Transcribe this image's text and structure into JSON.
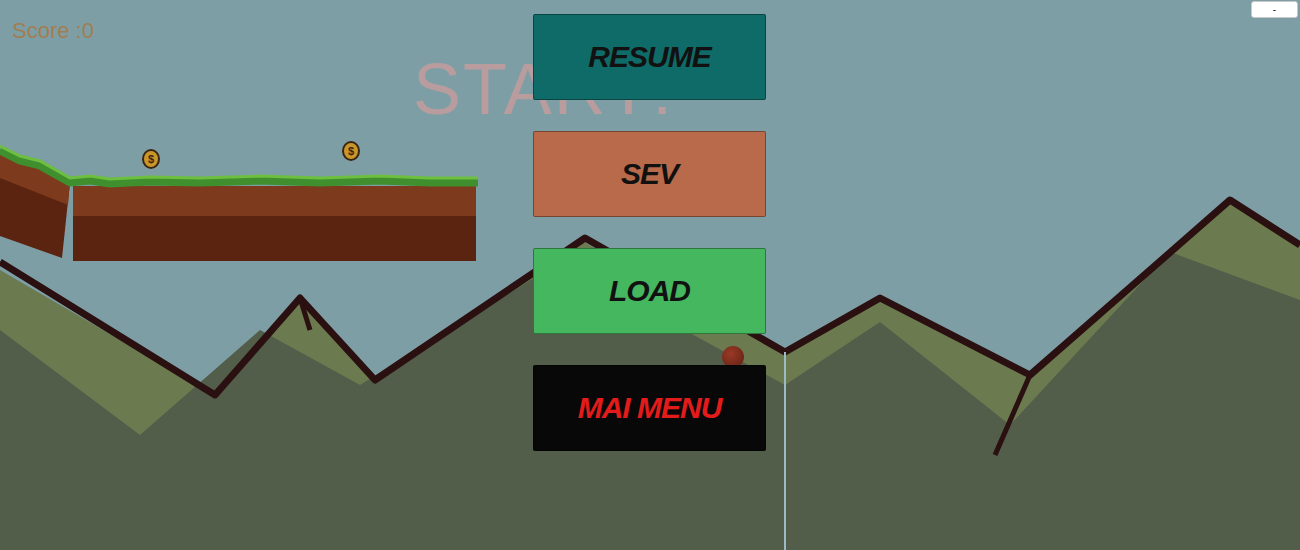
{
  "hud": {
    "score": "Score :0",
    "banner": "START!"
  },
  "window_control": {
    "label": "-"
  },
  "coins": [
    {
      "symbol": "$"
    },
    {
      "symbol": "$"
    }
  ],
  "pause_menu": {
    "buttons": [
      {
        "label": "RESUME",
        "color": "#0f6b68",
        "text_color": "#111111"
      },
      {
        "label": "SEV",
        "color": "#b96a4a",
        "text_color": "#111111"
      },
      {
        "label": "LOAD",
        "color": "#45b75f",
        "text_color": "#111111"
      },
      {
        "label": "MAI MENU",
        "color": "#080808",
        "text_color": "#e31b1b"
      }
    ]
  }
}
